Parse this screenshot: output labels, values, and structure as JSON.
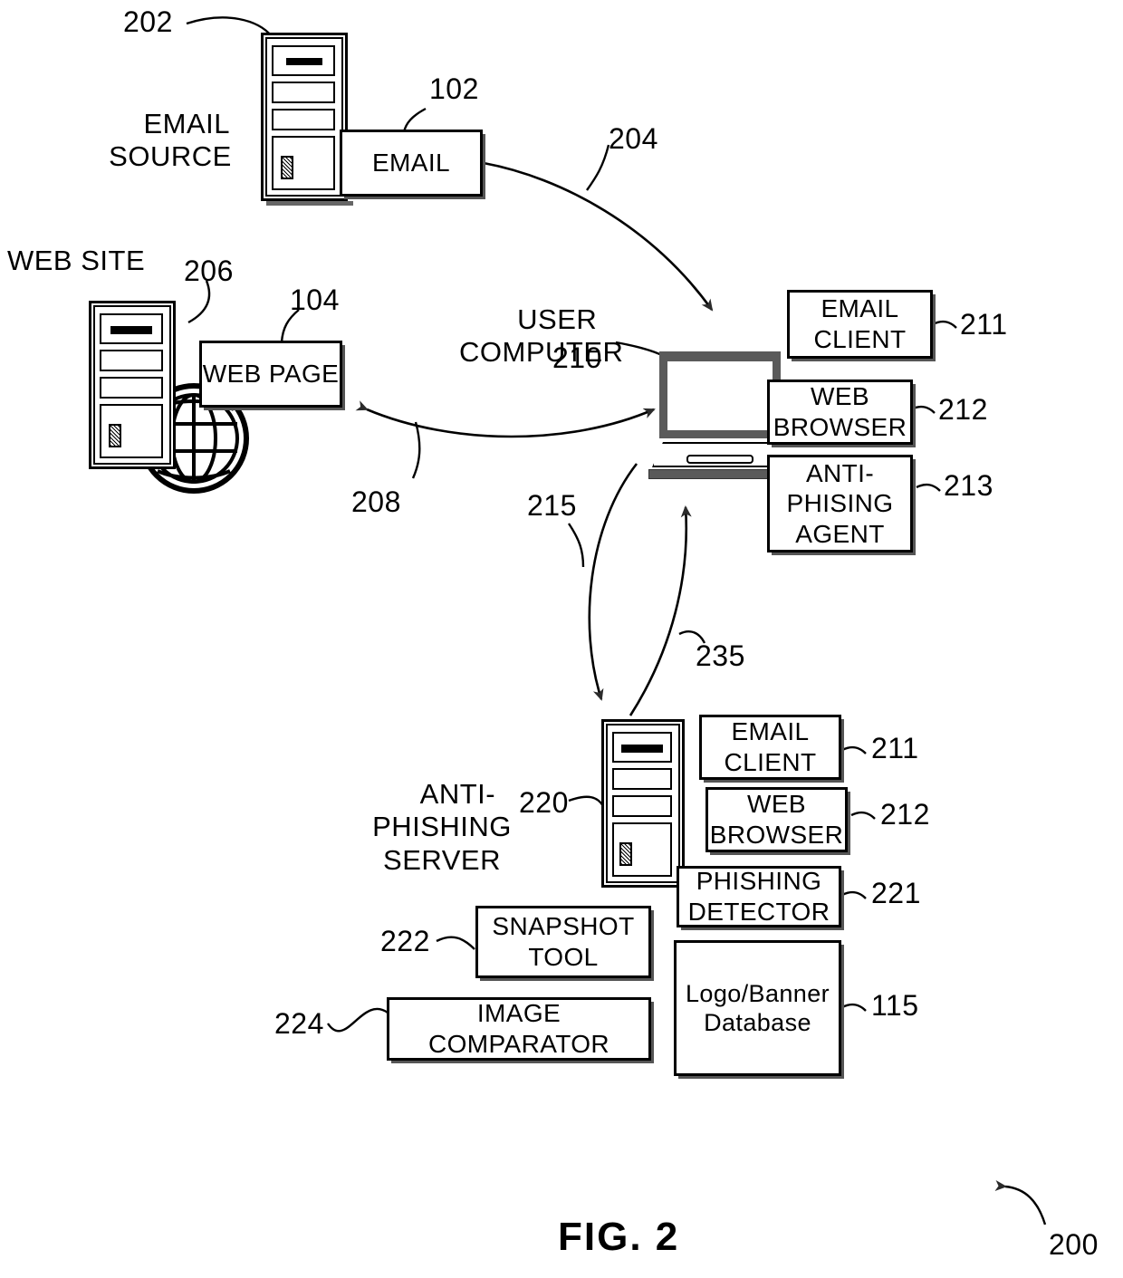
{
  "figure": {
    "caption": "FIG. 2",
    "overall_ref": "200"
  },
  "nodes": {
    "email_source": {
      "label": "EMAIL\nSOURCE",
      "ref": "202",
      "attached_box": {
        "label": "EMAIL",
        "ref": "102"
      }
    },
    "web_site": {
      "label": "WEB SITE",
      "ref": "206",
      "attached_box": {
        "label": "WEB PAGE",
        "ref": "104"
      },
      "icon": "globe-icon"
    },
    "user_computer": {
      "label": "USER\nCOMPUTER",
      "ref": "210",
      "components": [
        {
          "label": "EMAIL\nCLIENT",
          "ref": "211"
        },
        {
          "label": "WEB\nBROWSER",
          "ref": "212"
        },
        {
          "label": "ANTI-\nPHISING\nAGENT",
          "ref": "213"
        }
      ]
    },
    "anti_phishing_server": {
      "label": "ANTI-\nPHISHING\nSERVER",
      "ref": "220",
      "components": [
        {
          "label": "EMAIL\nCLIENT",
          "ref": "211"
        },
        {
          "label": "WEB\nBROWSER",
          "ref": "212"
        },
        {
          "label": "PHISHING\nDETECTOR",
          "ref": "221"
        },
        {
          "label": "Logo/Banner\nDatabase",
          "ref": "115"
        },
        {
          "label": "SNAPSHOT\nTOOL",
          "ref": "222"
        },
        {
          "label": "IMAGE COMPARATOR",
          "ref": "224"
        }
      ]
    }
  },
  "connectors": [
    {
      "ref": "204",
      "from": "email-box",
      "to": "user-computer",
      "heads": "single"
    },
    {
      "ref": "208",
      "from": "user-computer",
      "to": "web-page-box",
      "heads": "double"
    },
    {
      "ref": "215",
      "from": "user-computer",
      "to": "anti-phishing-server",
      "heads": "single"
    },
    {
      "ref": "235",
      "from": "anti-phishing-server",
      "to": "user-computer",
      "heads": "single"
    }
  ]
}
